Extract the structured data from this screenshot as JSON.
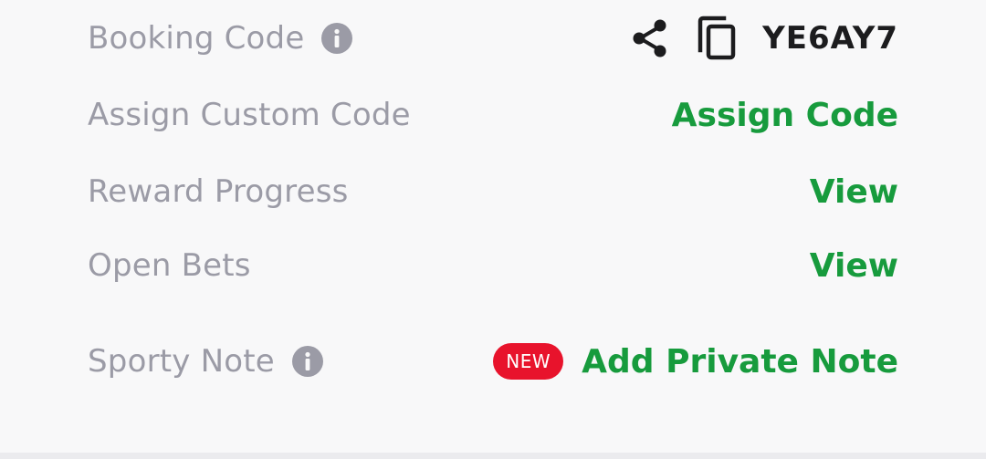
{
  "booking_code": {
    "label": "Booking Code",
    "info_icon": "info-icon",
    "share_icon": "share-icon",
    "copy_icon": "copy-icon",
    "value": "YE6AY7"
  },
  "custom_code": {
    "label": "Assign Custom Code",
    "action": "Assign Code"
  },
  "reward_progress": {
    "label": "Reward Progress",
    "action": "View"
  },
  "open_bets": {
    "label": "Open Bets",
    "action": "View"
  },
  "sporty_note": {
    "label": "Sporty Note",
    "info_icon": "info-icon",
    "badge": "NEW",
    "action": "Add Private Note"
  },
  "colors": {
    "background": "#f8f8f9",
    "label_gray": "#9b9ba6",
    "action_green": "#179b3d",
    "badge_red": "#e8132c",
    "code_black": "#1c1c1e"
  }
}
